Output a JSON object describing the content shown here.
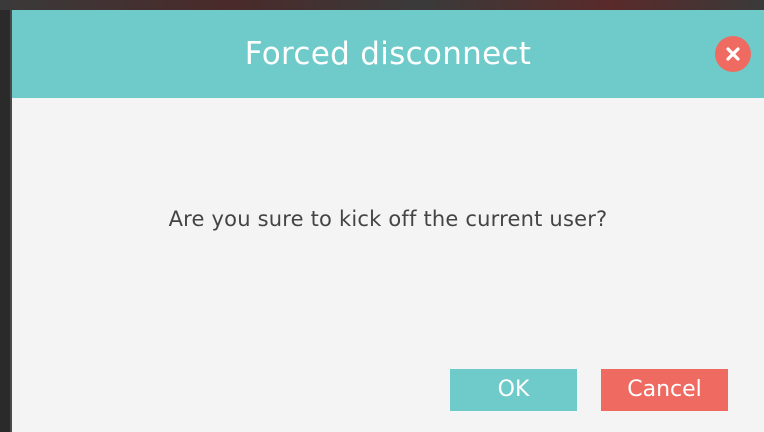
{
  "dialog": {
    "title": "Forced disconnect",
    "message": "Are you sure to kick off the current user?",
    "close_icon": "close-icon",
    "buttons": {
      "ok_label": "OK",
      "cancel_label": "Cancel"
    }
  },
  "colors": {
    "header": "#6ecbc9",
    "ok_button": "#6ecbc9",
    "cancel_button": "#ef6b61",
    "close_button": "#ef6b61",
    "body_background": "#f4f4f4",
    "message_text": "#444444"
  }
}
